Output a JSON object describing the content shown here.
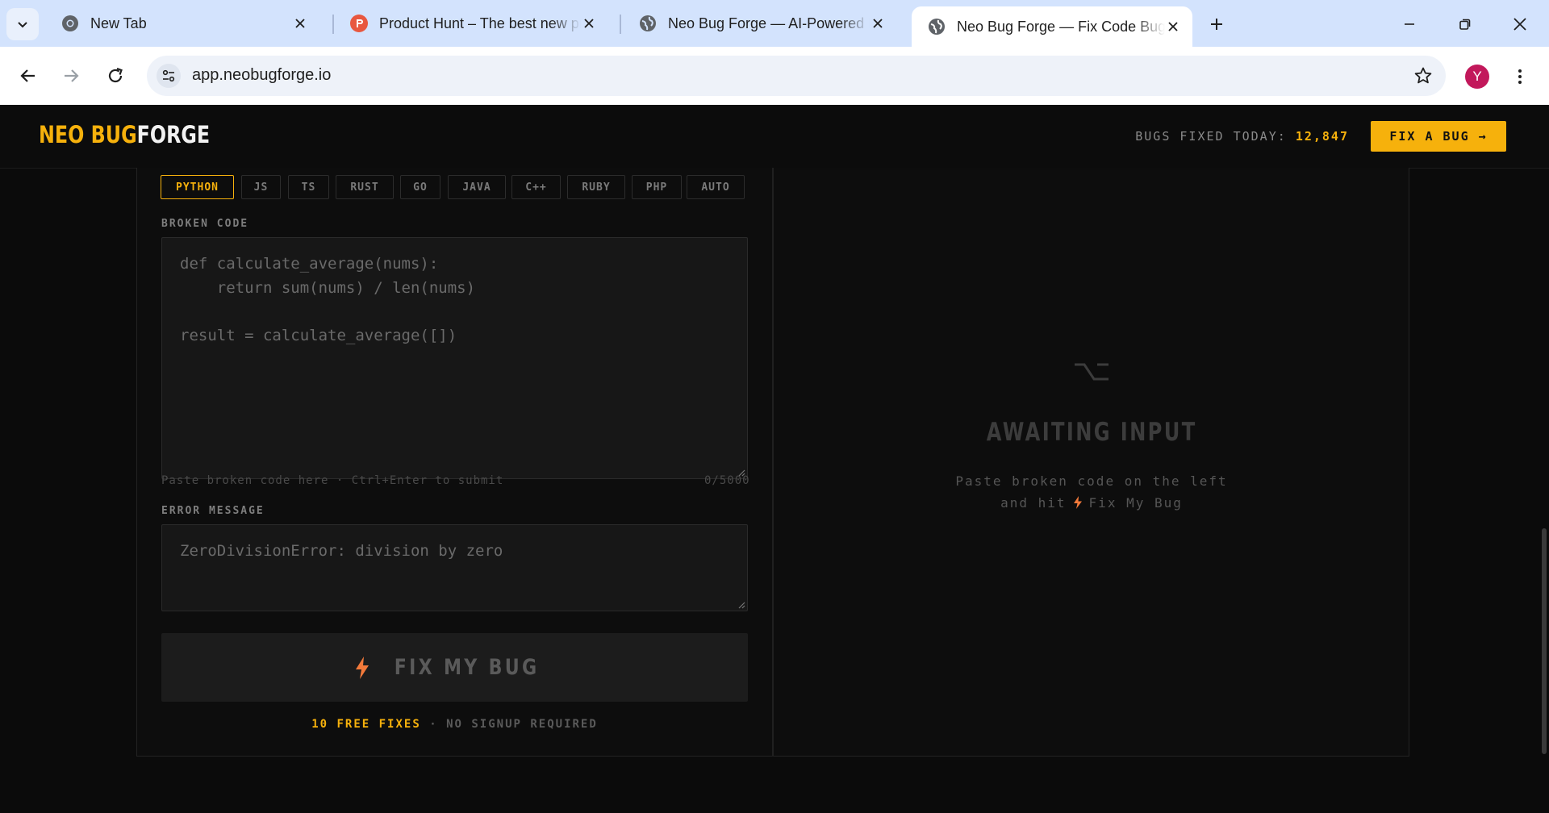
{
  "browser": {
    "tabs": [
      {
        "title": "New Tab",
        "icon": "chrome-icon"
      },
      {
        "title": "Product Hunt – The best new products",
        "icon": "product-hunt-icon"
      },
      {
        "title": "Neo Bug Forge — AI-Powered Bug Fixer",
        "icon": "globe-icon"
      },
      {
        "title": "Neo Bug Forge — Fix Code Bugs",
        "icon": "globe-icon",
        "active": true
      }
    ],
    "url": "app.neobugforge.io",
    "profile_initial": "Y"
  },
  "header": {
    "logo_part1": "NEO BUG",
    "logo_part2": "FORGE",
    "stat_label": "BUGS FIXED TODAY:",
    "stat_value": "12,847",
    "cta_label": "FIX A BUG →"
  },
  "editor": {
    "languages": [
      "PYTHON",
      "JS",
      "TS",
      "RUST",
      "GO",
      "JAVA",
      "C++",
      "RUBY",
      "PHP",
      "AUTO"
    ],
    "selected_language": "PYTHON",
    "code_label": "BROKEN CODE",
    "code_placeholder": "def calculate_average(nums):\n    return sum(nums) / len(nums)\n\nresult = calculate_average([])",
    "hint": "Paste broken code here · Ctrl+Enter to submit",
    "char_count": "0/5000",
    "error_label": "ERROR MESSAGE",
    "error_placeholder": "ZeroDivisionError: division by zero",
    "fix_button": "FIX MY BUG",
    "free_highlight": "10 FREE FIXES",
    "free_rest": " · NO SIGNUP REQUIRED"
  },
  "output": {
    "title": "AWAITING INPUT",
    "desc_line1": "Paste broken code on the left",
    "desc_line2_pre": "and hit",
    "desc_line2_post": "Fix My Bug"
  },
  "colors": {
    "accent": "#f6b10c",
    "bolt": "#f2793a",
    "background": "#0b0b0b"
  }
}
